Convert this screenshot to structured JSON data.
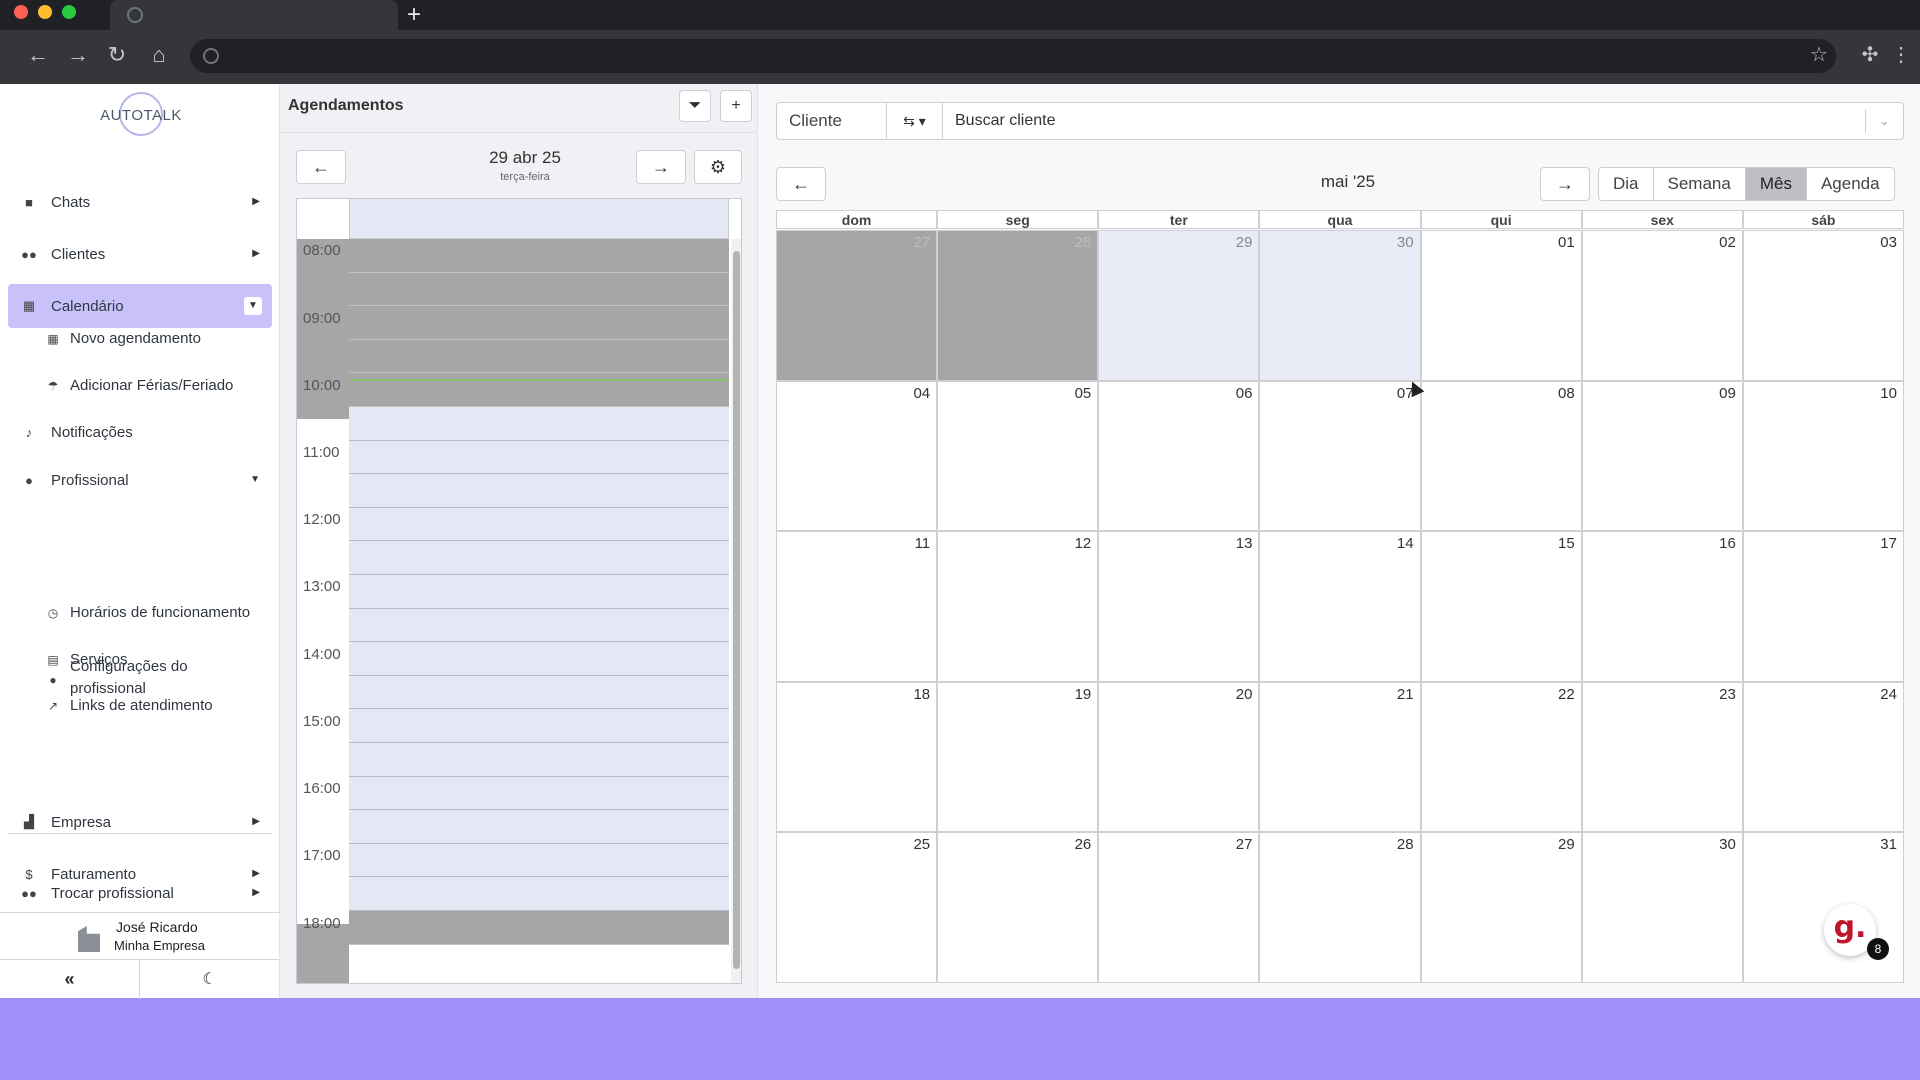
{
  "browser": {
    "new_tab_glyph": "+",
    "icons": [
      "back-arrow-icon",
      "forward-arrow-icon",
      "reload-icon",
      "home-icon",
      "globe-icon",
      "star-icon",
      "puzzle-icon",
      "kebab-menu-icon"
    ]
  },
  "sidebar": {
    "logo_text": "AUTOTALK",
    "items": [
      {
        "label": "Chats",
        "icon": "chat-icon"
      },
      {
        "label": "Clientes",
        "icon": "users-icon"
      },
      {
        "label": "Calendário",
        "icon": "calendar-icon",
        "active": true
      },
      {
        "label": "Novo agendamento",
        "icon": "calendar-plus-icon"
      },
      {
        "label": "Adicionar Férias/Feriado",
        "icon": "umbrella-icon"
      },
      {
        "label": "Notificações",
        "icon": "bell-icon"
      },
      {
        "label": "Profissional",
        "icon": "user-gear-icon"
      },
      {
        "label": "Horários de funcionamento",
        "icon": "clock-icon"
      },
      {
        "label": "Serviços",
        "icon": "clipboard-icon"
      },
      {
        "label": "Links de atendimento",
        "icon": "external-link-icon"
      },
      {
        "label": "Configurações do profissional",
        "icon": "user-cog-icon"
      },
      {
        "label": "Empresa",
        "icon": "building-icon"
      },
      {
        "label": "Faturamento",
        "icon": "dollar-icon"
      },
      {
        "label": "Trocar profissional",
        "icon": "users-swap-icon"
      }
    ],
    "user": {
      "name": "José Ricardo",
      "company": "Minha Empresa"
    },
    "accent_color": "#c8c1fa"
  },
  "agenda": {
    "title": "Agendamentos",
    "date_label": "29 abr 25",
    "weekday_label": "terça-feira",
    "times": [
      "08:00",
      "09:00",
      "10:00",
      "11:00",
      "12:00",
      "13:00",
      "14:00",
      "15:00",
      "16:00",
      "17:00",
      "18:00"
    ]
  },
  "calendar": {
    "search_label": "Cliente",
    "search_placeholder": "Buscar cliente",
    "month_title": "mai '25",
    "views": [
      "Dia",
      "Semana",
      "Mês",
      "Agenda"
    ],
    "active_view": "Mês",
    "weekdays": [
      "dom",
      "seg",
      "ter",
      "qua",
      "qui",
      "sex",
      "sáb"
    ],
    "weeks": [
      [
        "27",
        "28",
        "29",
        "30",
        "01",
        "02",
        "03"
      ],
      [
        "04",
        "05",
        "06",
        "07",
        "08",
        "09",
        "10"
      ],
      [
        "11",
        "12",
        "13",
        "14",
        "15",
        "16",
        "17"
      ],
      [
        "18",
        "19",
        "20",
        "21",
        "22",
        "23",
        "24"
      ],
      [
        "25",
        "26",
        "27",
        "28",
        "29",
        "30",
        "31"
      ]
    ]
  },
  "chat_widget": {
    "glyph": "g.",
    "badge_count": "8"
  },
  "colors": {
    "page_background": "#a28ff7",
    "blocked_slot": "#a6a6a6",
    "free_slot": "#e4e7f4"
  }
}
